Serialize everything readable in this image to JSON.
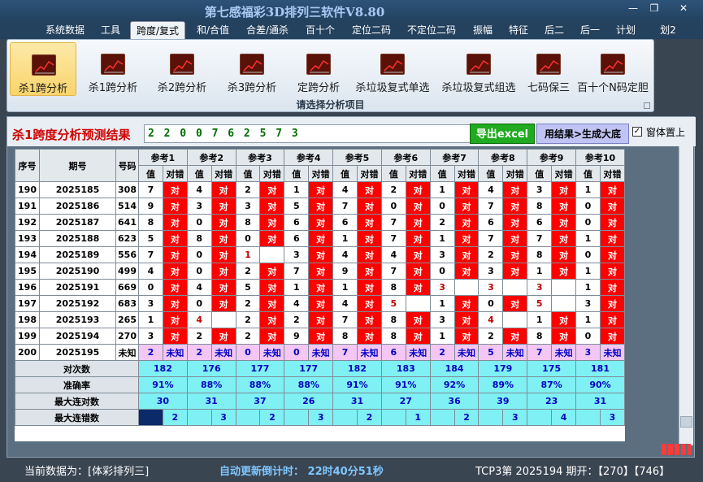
{
  "app": {
    "title": "第七感福彩3D排列三软件V8.80",
    "win_min": "—",
    "win_restore": "❐",
    "win_close": "✕"
  },
  "menu": [
    "系统数据",
    "工具",
    "跨度/复式",
    "和/合值",
    "合差/通杀",
    "百十个",
    "定位二码",
    "不定位二码",
    "振幅",
    "特征",
    "后二",
    "后一",
    "计划",
    "划2"
  ],
  "menu_active_index": 2,
  "ribbon": {
    "buttons": [
      "杀1跨分析",
      "杀1跨分析",
      "杀2跨分析",
      "杀3跨分析",
      "定跨分析",
      "杀垃圾复式单选",
      "杀垃圾复式组选",
      "七码保三",
      "百十个N码定胆"
    ],
    "active_index": 0,
    "caption": "请选择分析项目"
  },
  "panel": {
    "title": "杀1跨度分析预测结果",
    "result": "2 2 0 0 7 6 2 5 7 3",
    "excel_button": "导出excel",
    "generate_button": "用结果>生成大底",
    "checkbox_checked": "✓",
    "checkbox_label": "窗体置上"
  },
  "grid": {
    "head": {
      "seq": "序号",
      "issue": "期号",
      "number": "号码",
      "val": "值",
      "dui_cuo": "对错"
    },
    "refs": [
      "参考1",
      "参考2",
      "参考3",
      "参考4",
      "参考5",
      "参考6",
      "参考7",
      "参考8",
      "参考9",
      "参考10"
    ],
    "rows": [
      {
        "seq": "190",
        "issue": "2025185",
        "num": "308",
        "cells": [
          [
            "7",
            "对"
          ],
          [
            "4",
            "对"
          ],
          [
            "2",
            "对"
          ],
          [
            "1",
            "对"
          ],
          [
            "4",
            "对"
          ],
          [
            "2",
            "对"
          ],
          [
            "1",
            "对"
          ],
          [
            "4",
            "对"
          ],
          [
            "3",
            "对"
          ],
          [
            "1",
            "对"
          ]
        ]
      },
      {
        "seq": "191",
        "issue": "2025186",
        "num": "514",
        "cells": [
          [
            "9",
            "对"
          ],
          [
            "3",
            "对"
          ],
          [
            "3",
            "对"
          ],
          [
            "5",
            "对"
          ],
          [
            "7",
            "对"
          ],
          [
            "0",
            "对"
          ],
          [
            "0",
            "对"
          ],
          [
            "7",
            "对"
          ],
          [
            "8",
            "对"
          ],
          [
            "0",
            "对"
          ]
        ]
      },
      {
        "seq": "192",
        "issue": "2025187",
        "num": "641",
        "cells": [
          [
            "8",
            "对"
          ],
          [
            "0",
            "对"
          ],
          [
            "8",
            "对"
          ],
          [
            "6",
            "对"
          ],
          [
            "6",
            "对"
          ],
          [
            "7",
            "对"
          ],
          [
            "2",
            "对"
          ],
          [
            "6",
            "对"
          ],
          [
            "6",
            "对"
          ],
          [
            "0",
            "对"
          ]
        ]
      },
      {
        "seq": "193",
        "issue": "2025188",
        "num": "623",
        "cells": [
          [
            "5",
            "对"
          ],
          [
            "8",
            "对"
          ],
          [
            "0",
            "对"
          ],
          [
            "6",
            "对"
          ],
          [
            "1",
            "对"
          ],
          [
            "7",
            "对"
          ],
          [
            "1",
            "对"
          ],
          [
            "7",
            "对"
          ],
          [
            "7",
            "对"
          ],
          [
            "1",
            "对"
          ]
        ]
      },
      {
        "seq": "194",
        "issue": "2025189",
        "num": "556",
        "cells": [
          [
            "7",
            "对"
          ],
          [
            "0",
            "对"
          ],
          [
            "1",
            "错"
          ],
          [
            "3",
            "对"
          ],
          [
            "4",
            "对"
          ],
          [
            "4",
            "对"
          ],
          [
            "3",
            "对"
          ],
          [
            "2",
            "对"
          ],
          [
            "8",
            "对"
          ],
          [
            "0",
            "对"
          ]
        ]
      },
      {
        "seq": "195",
        "issue": "2025190",
        "num": "499",
        "cells": [
          [
            "4",
            "对"
          ],
          [
            "0",
            "对"
          ],
          [
            "2",
            "对"
          ],
          [
            "7",
            "对"
          ],
          [
            "9",
            "对"
          ],
          [
            "7",
            "对"
          ],
          [
            "0",
            "对"
          ],
          [
            "3",
            "对"
          ],
          [
            "1",
            "对"
          ],
          [
            "1",
            "对"
          ]
        ]
      },
      {
        "seq": "196",
        "issue": "2025191",
        "num": "669",
        "cells": [
          [
            "0",
            "对"
          ],
          [
            "4",
            "对"
          ],
          [
            "5",
            "对"
          ],
          [
            "1",
            "对"
          ],
          [
            "1",
            "对"
          ],
          [
            "8",
            "对"
          ],
          [
            "3",
            "错"
          ],
          [
            "3",
            "错"
          ],
          [
            "3",
            "错"
          ],
          [
            "1",
            "对"
          ]
        ]
      },
      {
        "seq": "197",
        "issue": "2025192",
        "num": "683",
        "cells": [
          [
            "3",
            "对"
          ],
          [
            "0",
            "对"
          ],
          [
            "2",
            "对"
          ],
          [
            "4",
            "对"
          ],
          [
            "4",
            "对"
          ],
          [
            "5",
            "错"
          ],
          [
            "1",
            "对"
          ],
          [
            "0",
            "对"
          ],
          [
            "5",
            "错"
          ],
          [
            "3",
            "对"
          ]
        ]
      },
      {
        "seq": "198",
        "issue": "2025193",
        "num": "265",
        "cells": [
          [
            "1",
            "对"
          ],
          [
            "4",
            "错"
          ],
          [
            "2",
            "对"
          ],
          [
            "2",
            "对"
          ],
          [
            "7",
            "对"
          ],
          [
            "8",
            "对"
          ],
          [
            "3",
            "对"
          ],
          [
            "4",
            "错"
          ],
          [
            "1",
            "对"
          ],
          [
            "1",
            "对"
          ]
        ]
      },
      {
        "seq": "199",
        "issue": "2025194",
        "num": "270",
        "cells": [
          [
            "3",
            "对"
          ],
          [
            "2",
            "对"
          ],
          [
            "2",
            "对"
          ],
          [
            "9",
            "对"
          ],
          [
            "8",
            "对"
          ],
          [
            "8",
            "对"
          ],
          [
            "1",
            "对"
          ],
          [
            "2",
            "对"
          ],
          [
            "8",
            "对"
          ],
          [
            "0",
            "对"
          ]
        ]
      }
    ],
    "predict_row": {
      "seq": "200",
      "issue": "2025195",
      "num": "未知",
      "cells": [
        [
          "2",
          "未知"
        ],
        [
          "2",
          "未知"
        ],
        [
          "0",
          "未知"
        ],
        [
          "0",
          "未知"
        ],
        [
          "7",
          "未知"
        ],
        [
          "6",
          "未知"
        ],
        [
          "2",
          "未知"
        ],
        [
          "5",
          "未知"
        ],
        [
          "7",
          "未知"
        ],
        [
          "3",
          "未知"
        ]
      ]
    },
    "stats": [
      {
        "label": "对次数",
        "values": [
          "182",
          "176",
          "177",
          "177",
          "182",
          "183",
          "184",
          "179",
          "175",
          "181"
        ]
      },
      {
        "label": "准确率",
        "values": [
          "91%",
          "88%",
          "88%",
          "88%",
          "91%",
          "91%",
          "92%",
          "89%",
          "87%",
          "90%"
        ]
      },
      {
        "label": "最大连对数",
        "values": [
          "30",
          "31",
          "37",
          "26",
          "31",
          "27",
          "36",
          "39",
          "23",
          "31"
        ]
      },
      {
        "label": "最大连错数",
        "values": [
          "",
          "2",
          "3",
          "2",
          "3",
          "2",
          "1",
          "2",
          "3",
          "4",
          "3"
        ]
      }
    ]
  },
  "status": {
    "source_prefix": "当前数据为：",
    "source": "[体彩排列三]",
    "countdown_label": "自动更新倒计时：",
    "countdown": "22时40分51秒",
    "latest": "TCP3第 2025194 期开：【270】【746】"
  },
  "colors": {
    "hit": "#ff0000",
    "miss": "#c00000",
    "predict": "#f3c6f3",
    "stats": "#7ff0f4",
    "result_text": "#006c00"
  }
}
